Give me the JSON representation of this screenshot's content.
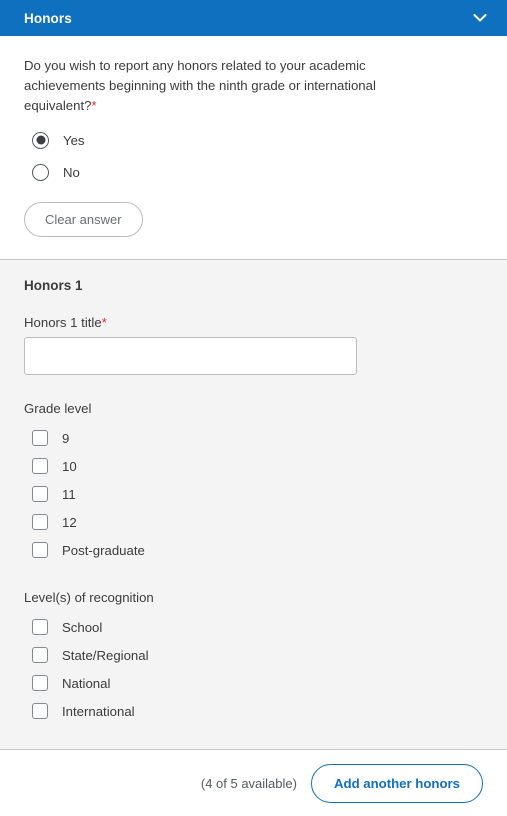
{
  "header": {
    "title": "Honors",
    "collapse_icon": "chevron-down-icon"
  },
  "question": {
    "text": "Do you wish to report any honors related to your academic achievements beginning with the ninth grade or international equivalent?",
    "required_marker": "*",
    "options": [
      {
        "label": "Yes",
        "selected": true
      },
      {
        "label": "No",
        "selected": false
      }
    ],
    "clear_button_label": "Clear answer"
  },
  "honors_section": {
    "title": "Honors 1",
    "title_field": {
      "label": "Honors 1 title",
      "required_marker": "*",
      "value": "",
      "placeholder": ""
    },
    "grade_level": {
      "label": "Grade level",
      "options": [
        {
          "label": "9",
          "checked": false
        },
        {
          "label": "10",
          "checked": false
        },
        {
          "label": "11",
          "checked": false
        },
        {
          "label": "12",
          "checked": false
        },
        {
          "label": "Post-graduate",
          "checked": false
        }
      ]
    },
    "recognition_level": {
      "label": "Level(s) of recognition",
      "options": [
        {
          "label": "School",
          "checked": false
        },
        {
          "label": "State/Regional",
          "checked": false
        },
        {
          "label": "National",
          "checked": false
        },
        {
          "label": "International",
          "checked": false
        }
      ]
    }
  },
  "footer": {
    "availability_text": "(4 of 5 available)",
    "add_button_label": "Add another honors"
  },
  "colors": {
    "header_blue": "#1070c0",
    "accent_blue": "#1070c0",
    "required_red": "#e0203c",
    "section_bg": "#f4f4f4",
    "border_gray": "#b9bdc1"
  }
}
